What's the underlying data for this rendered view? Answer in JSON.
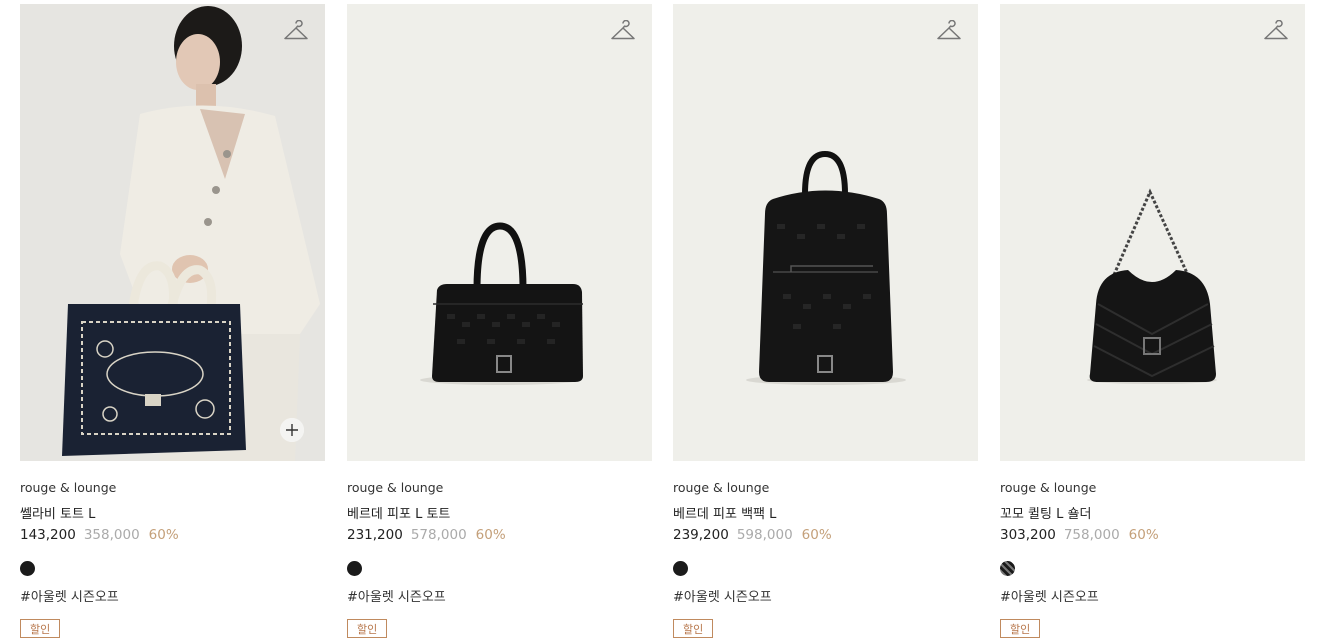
{
  "products": [
    {
      "brand": "rouge & lounge",
      "name": "쎌라비 토트 L",
      "price": "143,200",
      "original_price": "358,000",
      "discount": "60%",
      "swatch": "black",
      "tag": "#아울렛 시즌오프",
      "badge": "할인",
      "image": "woman-holding-tote-bag"
    },
    {
      "brand": "rouge & lounge",
      "name": "베르데 피포 L 토트",
      "price": "231,200",
      "original_price": "578,000",
      "discount": "60%",
      "swatch": "black",
      "tag": "#아울렛 시즌오프",
      "badge": "할인",
      "image": "black-tote-bag"
    },
    {
      "brand": "rouge & lounge",
      "name": "베르데 피포 백팩 L",
      "price": "239,200",
      "original_price": "598,000",
      "discount": "60%",
      "swatch": "black",
      "tag": "#아울렛 시즌오프",
      "badge": "할인",
      "image": "black-backpack"
    },
    {
      "brand": "rouge & lounge",
      "name": "꼬모 퀼팅 L 숄더",
      "price": "303,200",
      "original_price": "758,000",
      "discount": "60%",
      "swatch": "black-pattern",
      "tag": "#아울렛 시즌오프",
      "badge": "할인",
      "image": "black-quilted-shoulder-bag"
    }
  ],
  "icons": {
    "wishlist": "hanger-icon",
    "quick_add": "plus-icon"
  },
  "colors": {
    "discount": "#c4a07a",
    "badge": "#b7764a",
    "image_bg": "#efefea"
  }
}
